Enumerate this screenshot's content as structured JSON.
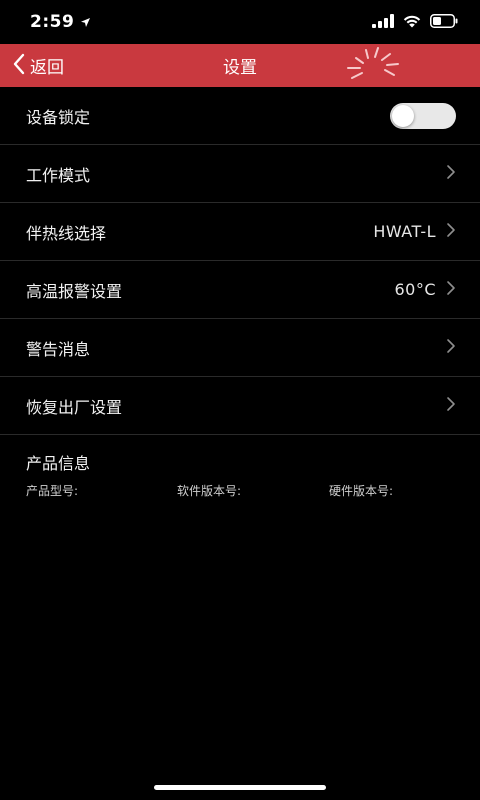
{
  "status_bar": {
    "time": "2:59",
    "icons": [
      "location-arrow-icon",
      "signal-icon",
      "wifi-icon",
      "battery-icon"
    ]
  },
  "header": {
    "back_label": "返回",
    "title": "设置",
    "accent_color": "#c9393f"
  },
  "settings": {
    "lock": {
      "label": "设备锁定",
      "toggle_on": false
    },
    "work_mode": {
      "label": "工作模式"
    },
    "cable": {
      "label": "伴热线选择",
      "value": "HWAT-L"
    },
    "high_temp_alarm": {
      "label": "高温报警设置",
      "value": "60°C"
    },
    "warning_messages": {
      "label": "警告消息"
    },
    "factory_reset": {
      "label": "恢复出厂设置"
    }
  },
  "product_info": {
    "title": "产品信息",
    "model_label": "产品型号:",
    "software_version_label": "软件版本号:",
    "hardware_version_label": "硬件版本号:"
  }
}
